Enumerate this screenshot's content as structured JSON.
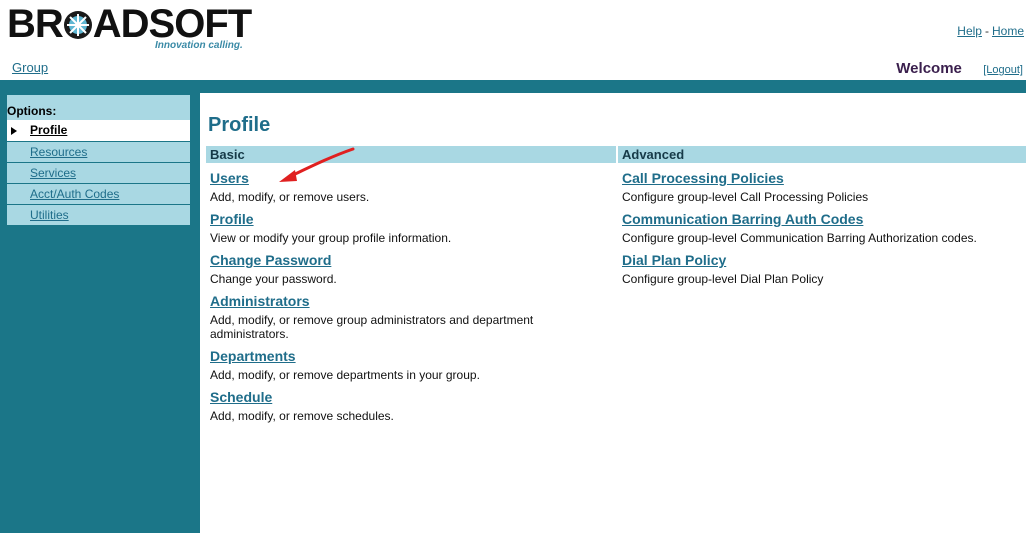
{
  "header": {
    "logo_text": "BROADSOFT",
    "tagline": "Innovation calling.",
    "help_label": "Help",
    "separator": "-",
    "home_label": "Home",
    "group_label": "Group",
    "welcome_label": "Welcome",
    "logout_label": "[Logout]"
  },
  "sidebar": {
    "title": "Options:",
    "items": [
      {
        "label": "Profile"
      },
      {
        "label": "Resources"
      },
      {
        "label": "Services"
      },
      {
        "label": "Acct/Auth Codes"
      },
      {
        "label": "Utilities"
      }
    ]
  },
  "main": {
    "title": "Profile",
    "basic": {
      "heading": "Basic",
      "items": [
        {
          "title": "Users",
          "desc": "Add, modify, or remove users."
        },
        {
          "title": "Profile",
          "desc": "View or modify your group profile information."
        },
        {
          "title": "Change Password",
          "desc": "Change your password."
        },
        {
          "title": "Administrators",
          "desc": "Add, modify, or remove group administrators and department administrators."
        },
        {
          "title": "Departments",
          "desc": "Add, modify, or remove departments in your group."
        },
        {
          "title": "Schedule",
          "desc": "Add, modify, or remove schedules."
        }
      ]
    },
    "advanced": {
      "heading": "Advanced",
      "items": [
        {
          "title": "Call Processing Policies",
          "desc": "Configure group-level Call Processing Policies"
        },
        {
          "title": "Communication Barring Auth Codes",
          "desc": "Configure group-level Communication Barring Authorization codes."
        },
        {
          "title": "Dial Plan Policy",
          "desc": "Configure group-level Dial Plan Policy"
        }
      ]
    }
  },
  "colors": {
    "teal": "#1b7688",
    "light_blue": "#a9d8e3",
    "link": "#1f6d8a",
    "arrow": "#e02020"
  },
  "icons": [
    "broadsoft-star-logo-icon",
    "bullet-arrow-icon",
    "red-annotation-arrow-icon"
  ]
}
